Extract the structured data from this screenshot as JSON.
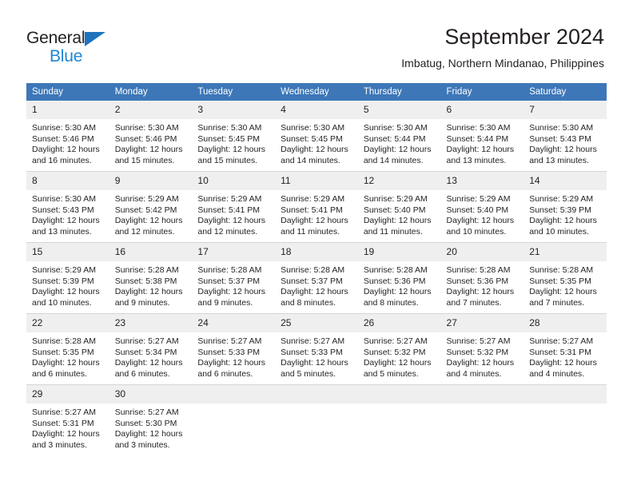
{
  "brand": {
    "name_dark": "General",
    "name_blue": "Blue",
    "accent_blue": "#1e86d4",
    "triangle_blue": "#1e73be"
  },
  "header": {
    "title": "September 2024",
    "subtitle": "Imbatug, Northern Mindanao, Philippines",
    "header_bg": "#3d77b8",
    "header_text_color": "#ffffff",
    "daynum_bg": "#efefef"
  },
  "weekdays": [
    "Sunday",
    "Monday",
    "Tuesday",
    "Wednesday",
    "Thursday",
    "Friday",
    "Saturday"
  ],
  "calendar": {
    "weeks": [
      [
        {
          "day": "1",
          "sunrise": "Sunrise: 5:30 AM",
          "sunset": "Sunset: 5:46 PM",
          "daylight_1": "Daylight: 12 hours",
          "daylight_2": "and 16 minutes."
        },
        {
          "day": "2",
          "sunrise": "Sunrise: 5:30 AM",
          "sunset": "Sunset: 5:46 PM",
          "daylight_1": "Daylight: 12 hours",
          "daylight_2": "and 15 minutes."
        },
        {
          "day": "3",
          "sunrise": "Sunrise: 5:30 AM",
          "sunset": "Sunset: 5:45 PM",
          "daylight_1": "Daylight: 12 hours",
          "daylight_2": "and 15 minutes."
        },
        {
          "day": "4",
          "sunrise": "Sunrise: 5:30 AM",
          "sunset": "Sunset: 5:45 PM",
          "daylight_1": "Daylight: 12 hours",
          "daylight_2": "and 14 minutes."
        },
        {
          "day": "5",
          "sunrise": "Sunrise: 5:30 AM",
          "sunset": "Sunset: 5:44 PM",
          "daylight_1": "Daylight: 12 hours",
          "daylight_2": "and 14 minutes."
        },
        {
          "day": "6",
          "sunrise": "Sunrise: 5:30 AM",
          "sunset": "Sunset: 5:44 PM",
          "daylight_1": "Daylight: 12 hours",
          "daylight_2": "and 13 minutes."
        },
        {
          "day": "7",
          "sunrise": "Sunrise: 5:30 AM",
          "sunset": "Sunset: 5:43 PM",
          "daylight_1": "Daylight: 12 hours",
          "daylight_2": "and 13 minutes."
        }
      ],
      [
        {
          "day": "8",
          "sunrise": "Sunrise: 5:30 AM",
          "sunset": "Sunset: 5:43 PM",
          "daylight_1": "Daylight: 12 hours",
          "daylight_2": "and 13 minutes."
        },
        {
          "day": "9",
          "sunrise": "Sunrise: 5:29 AM",
          "sunset": "Sunset: 5:42 PM",
          "daylight_1": "Daylight: 12 hours",
          "daylight_2": "and 12 minutes."
        },
        {
          "day": "10",
          "sunrise": "Sunrise: 5:29 AM",
          "sunset": "Sunset: 5:41 PM",
          "daylight_1": "Daylight: 12 hours",
          "daylight_2": "and 12 minutes."
        },
        {
          "day": "11",
          "sunrise": "Sunrise: 5:29 AM",
          "sunset": "Sunset: 5:41 PM",
          "daylight_1": "Daylight: 12 hours",
          "daylight_2": "and 11 minutes."
        },
        {
          "day": "12",
          "sunrise": "Sunrise: 5:29 AM",
          "sunset": "Sunset: 5:40 PM",
          "daylight_1": "Daylight: 12 hours",
          "daylight_2": "and 11 minutes."
        },
        {
          "day": "13",
          "sunrise": "Sunrise: 5:29 AM",
          "sunset": "Sunset: 5:40 PM",
          "daylight_1": "Daylight: 12 hours",
          "daylight_2": "and 10 minutes."
        },
        {
          "day": "14",
          "sunrise": "Sunrise: 5:29 AM",
          "sunset": "Sunset: 5:39 PM",
          "daylight_1": "Daylight: 12 hours",
          "daylight_2": "and 10 minutes."
        }
      ],
      [
        {
          "day": "15",
          "sunrise": "Sunrise: 5:29 AM",
          "sunset": "Sunset: 5:39 PM",
          "daylight_1": "Daylight: 12 hours",
          "daylight_2": "and 10 minutes."
        },
        {
          "day": "16",
          "sunrise": "Sunrise: 5:28 AM",
          "sunset": "Sunset: 5:38 PM",
          "daylight_1": "Daylight: 12 hours",
          "daylight_2": "and 9 minutes."
        },
        {
          "day": "17",
          "sunrise": "Sunrise: 5:28 AM",
          "sunset": "Sunset: 5:37 PM",
          "daylight_1": "Daylight: 12 hours",
          "daylight_2": "and 9 minutes."
        },
        {
          "day": "18",
          "sunrise": "Sunrise: 5:28 AM",
          "sunset": "Sunset: 5:37 PM",
          "daylight_1": "Daylight: 12 hours",
          "daylight_2": "and 8 minutes."
        },
        {
          "day": "19",
          "sunrise": "Sunrise: 5:28 AM",
          "sunset": "Sunset: 5:36 PM",
          "daylight_1": "Daylight: 12 hours",
          "daylight_2": "and 8 minutes."
        },
        {
          "day": "20",
          "sunrise": "Sunrise: 5:28 AM",
          "sunset": "Sunset: 5:36 PM",
          "daylight_1": "Daylight: 12 hours",
          "daylight_2": "and 7 minutes."
        },
        {
          "day": "21",
          "sunrise": "Sunrise: 5:28 AM",
          "sunset": "Sunset: 5:35 PM",
          "daylight_1": "Daylight: 12 hours",
          "daylight_2": "and 7 minutes."
        }
      ],
      [
        {
          "day": "22",
          "sunrise": "Sunrise: 5:28 AM",
          "sunset": "Sunset: 5:35 PM",
          "daylight_1": "Daylight: 12 hours",
          "daylight_2": "and 6 minutes."
        },
        {
          "day": "23",
          "sunrise": "Sunrise: 5:27 AM",
          "sunset": "Sunset: 5:34 PM",
          "daylight_1": "Daylight: 12 hours",
          "daylight_2": "and 6 minutes."
        },
        {
          "day": "24",
          "sunrise": "Sunrise: 5:27 AM",
          "sunset": "Sunset: 5:33 PM",
          "daylight_1": "Daylight: 12 hours",
          "daylight_2": "and 6 minutes."
        },
        {
          "day": "25",
          "sunrise": "Sunrise: 5:27 AM",
          "sunset": "Sunset: 5:33 PM",
          "daylight_1": "Daylight: 12 hours",
          "daylight_2": "and 5 minutes."
        },
        {
          "day": "26",
          "sunrise": "Sunrise: 5:27 AM",
          "sunset": "Sunset: 5:32 PM",
          "daylight_1": "Daylight: 12 hours",
          "daylight_2": "and 5 minutes."
        },
        {
          "day": "27",
          "sunrise": "Sunrise: 5:27 AM",
          "sunset": "Sunset: 5:32 PM",
          "daylight_1": "Daylight: 12 hours",
          "daylight_2": "and 4 minutes."
        },
        {
          "day": "28",
          "sunrise": "Sunrise: 5:27 AM",
          "sunset": "Sunset: 5:31 PM",
          "daylight_1": "Daylight: 12 hours",
          "daylight_2": "and 4 minutes."
        }
      ],
      [
        {
          "day": "29",
          "sunrise": "Sunrise: 5:27 AM",
          "sunset": "Sunset: 5:31 PM",
          "daylight_1": "Daylight: 12 hours",
          "daylight_2": "and 3 minutes."
        },
        {
          "day": "30",
          "sunrise": "Sunrise: 5:27 AM",
          "sunset": "Sunset: 5:30 PM",
          "daylight_1": "Daylight: 12 hours",
          "daylight_2": "and 3 minutes."
        },
        {
          "day": "",
          "sunrise": "",
          "sunset": "",
          "daylight_1": "",
          "daylight_2": ""
        },
        {
          "day": "",
          "sunrise": "",
          "sunset": "",
          "daylight_1": "",
          "daylight_2": ""
        },
        {
          "day": "",
          "sunrise": "",
          "sunset": "",
          "daylight_1": "",
          "daylight_2": ""
        },
        {
          "day": "",
          "sunrise": "",
          "sunset": "",
          "daylight_1": "",
          "daylight_2": ""
        },
        {
          "day": "",
          "sunrise": "",
          "sunset": "",
          "daylight_1": "",
          "daylight_2": ""
        }
      ]
    ]
  }
}
